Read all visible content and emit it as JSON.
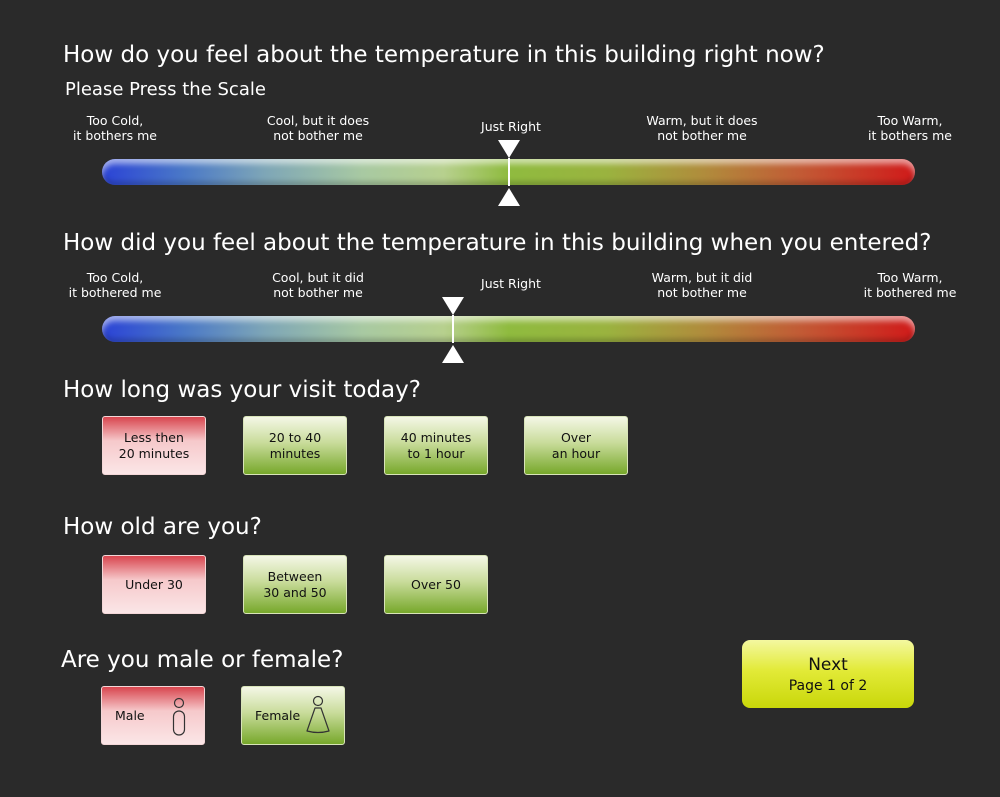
{
  "q1": {
    "question": "How do you feel about the temperature in this building right now?",
    "instruction": "Please Press the Scale",
    "labels": [
      "Too Cold,\nit bothers me",
      "Cool, but it does\nnot bother me",
      "Just Right",
      "Warm, but it does\nnot bother me",
      "Too Warm,\nit bothers me"
    ],
    "marker_value": 0.5
  },
  "q2": {
    "question": "How did you feel about the temperature in this building when you entered?",
    "labels": [
      "Too Cold,\nit bothered me",
      "Cool, but it did\nnot bother me",
      "Just Right",
      "Warm, but it did\nnot bother me",
      "Too Warm,\nit bothered me"
    ],
    "marker_value": 0.43
  },
  "visit": {
    "question": "How long was your visit today?",
    "options": [
      "Less then\n20 minutes",
      "20 to 40\nminutes",
      "40 minutes\nto 1 hour",
      "Over\nan hour"
    ],
    "selected": "Less then\n20 minutes"
  },
  "age": {
    "question": "How old are you?",
    "options": [
      "Under 30",
      "Between\n30 and 50",
      "Over 50"
    ],
    "selected": "Under 30"
  },
  "gender": {
    "question": "Are you male or female?",
    "options": [
      {
        "label": "Male",
        "icon": "male-figure-icon"
      },
      {
        "label": "Female",
        "icon": "female-figure-icon"
      }
    ],
    "selected": "Male"
  },
  "next": {
    "label": "Next",
    "page": "Page 1 of 2"
  },
  "colors": {
    "background": "#2a2a2a",
    "scale_cold": "#2b43d6",
    "scale_neutral": "#8fbb3f",
    "scale_hot": "#d01a1a",
    "selected_option": "#f6c9cb",
    "unselected_option": "#a8c86a",
    "next_button": "#e2ea37"
  }
}
